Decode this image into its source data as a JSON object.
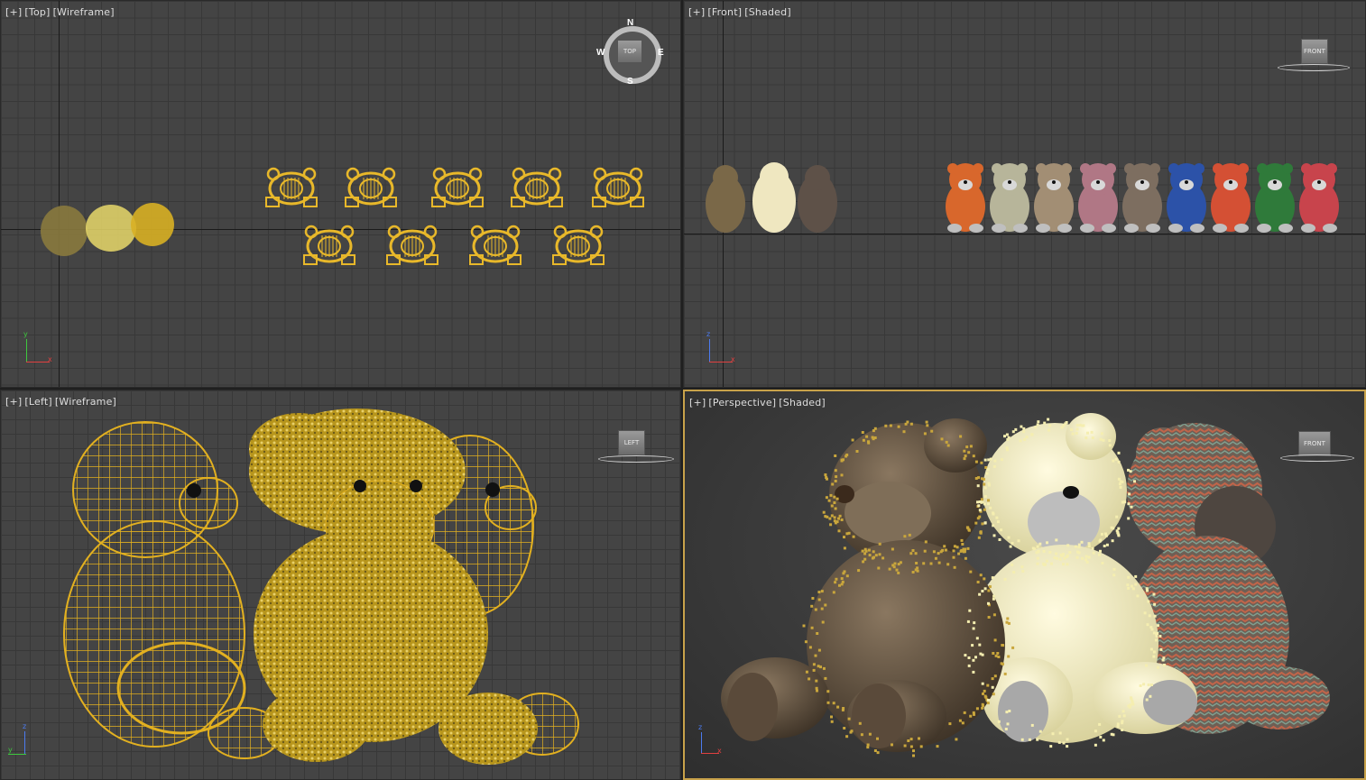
{
  "viewports": {
    "top": {
      "plus": "[+]",
      "view": "[Top]",
      "mode": "[Wireframe]",
      "cube": "TOP",
      "compass": {
        "n": "N",
        "s": "S",
        "e": "E",
        "w": "W"
      }
    },
    "front": {
      "plus": "[+]",
      "view": "[Front]",
      "mode": "[Shaded]",
      "cube": "FRONT"
    },
    "left": {
      "plus": "[+]",
      "view": "[Left]",
      "mode": "[Wireframe]",
      "cube": "LEFT"
    },
    "perspective": {
      "plus": "[+]",
      "view": "[Perspective]",
      "mode": "[Shaded]",
      "cube": "FRONT"
    }
  },
  "axes": {
    "x": "x",
    "y": "y",
    "z": "z"
  },
  "colors": {
    "viewport_bg": "#444444",
    "grid": "#383838",
    "wire": "#e8b82a",
    "active_border": "#c8a24a",
    "fur_brown": "#6b5a42",
    "fur_cream": "#f1ecc6",
    "knit": "#7a6a5c"
  },
  "front_bear_colors": [
    "#d8672c",
    "#b7b59a",
    "#a28e74",
    "#b07785",
    "#7d6e60",
    "#2c52a8",
    "#d45034",
    "#2f7a3a",
    "#c8444c"
  ]
}
